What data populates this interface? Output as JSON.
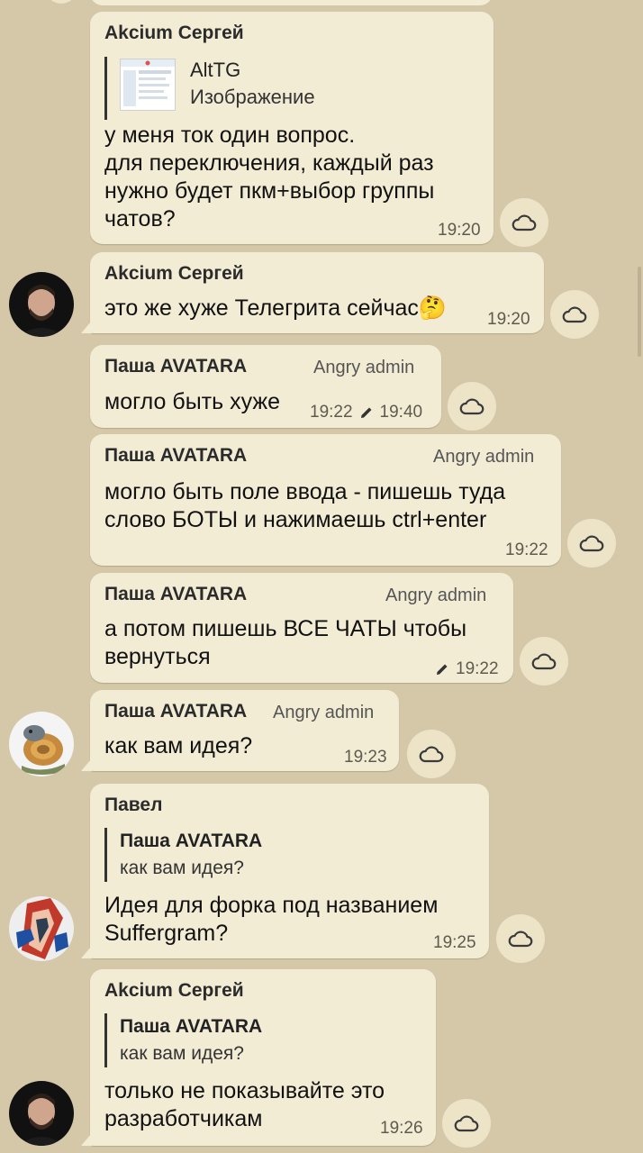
{
  "colors": {
    "background": "#d4c8a9",
    "bubble": "#f3ecd5",
    "accent": "#333333"
  },
  "messages": [
    {
      "sender": "Akcium Сергей",
      "reply": {
        "name": "AltTG",
        "text": "Изображение",
        "has_image": true
      },
      "lines": [
        "у меня ток один вопрос.",
        "для переключения, каждый раз",
        "нужно будет пкм+выбор группы",
        "чатов?"
      ],
      "time": "19:20"
    },
    {
      "sender": "Akcium Сергей",
      "lines": [
        "это же хуже Телегрита сейчас🤔"
      ],
      "time": "19:20"
    },
    {
      "sender": "Паша AVATARA",
      "role": "Angry admin",
      "lines": [
        "могло быть хуже"
      ],
      "time": "19:22",
      "edited_time": "19:40"
    },
    {
      "sender": "Паша AVATARA",
      "role": "Angry admin",
      "lines": [
        "могло быть поле ввода - пишешь туда",
        "слово БОТЫ и нажимаешь ctrl+enter"
      ],
      "time": "19:22"
    },
    {
      "sender": "Паша AVATARA",
      "role": "Angry admin",
      "lines": [
        "а потом пишешь ВСЕ ЧАТЫ чтобы",
        "вернуться"
      ],
      "time": "19:22"
    },
    {
      "sender": "Паша AVATARA",
      "role": "Angry admin",
      "lines": [
        "как вам идея?"
      ],
      "time": "19:23"
    },
    {
      "sender": "Павел",
      "reply": {
        "name": "Паша AVATARA",
        "text": "как вам идея?"
      },
      "lines": [
        "Идея для форка под названием",
        "Suffergram?"
      ],
      "time": "19:25"
    },
    {
      "sender": "Akcium Сергей",
      "reply": {
        "name": "Паша AVATARA",
        "text": "как вам идея?"
      },
      "lines": [
        "только не показывайте это",
        "разработчикам"
      ],
      "time": "19:26"
    }
  ],
  "icons": {
    "action": "cloud-icon",
    "edited": "pencil-icon"
  }
}
